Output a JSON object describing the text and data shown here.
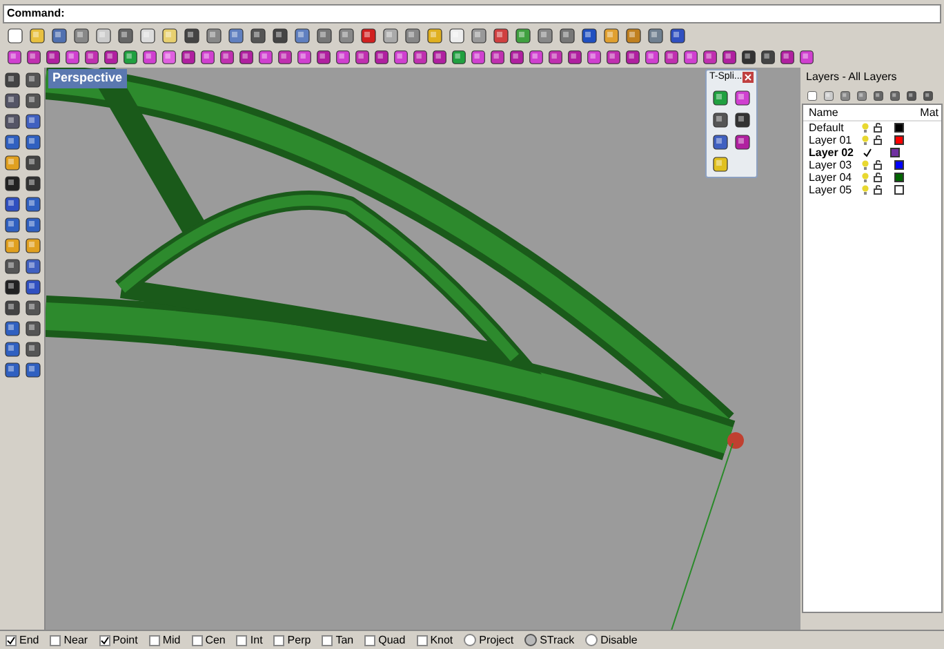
{
  "command_bar": {
    "label": "Command:"
  },
  "viewport": {
    "tab": "Perspective"
  },
  "tspline_panel": {
    "title": "T-Spli..."
  },
  "layers_panel": {
    "title": "Layers - All Layers",
    "columns": [
      "Name",
      "Mat"
    ],
    "layers": [
      {
        "name": "Default",
        "current": false,
        "color": "#000000"
      },
      {
        "name": "Layer 01",
        "current": false,
        "color": "#ff0000"
      },
      {
        "name": "Layer 02",
        "current": true,
        "color": "#7030a0"
      },
      {
        "name": "Layer 03",
        "current": false,
        "color": "#0000ff"
      },
      {
        "name": "Layer 04",
        "current": false,
        "color": "#006400"
      },
      {
        "name": "Layer 05",
        "current": false,
        "color": "#ffffff"
      }
    ]
  },
  "osnaps": [
    {
      "kind": "check",
      "label": "End",
      "checked": true
    },
    {
      "kind": "check",
      "label": "Near",
      "checked": false
    },
    {
      "kind": "check",
      "label": "Point",
      "checked": true
    },
    {
      "kind": "check",
      "label": "Mid",
      "checked": false
    },
    {
      "kind": "check",
      "label": "Cen",
      "checked": false
    },
    {
      "kind": "check",
      "label": "Int",
      "checked": false
    },
    {
      "kind": "check",
      "label": "Perp",
      "checked": false
    },
    {
      "kind": "check",
      "label": "Tan",
      "checked": false
    },
    {
      "kind": "check",
      "label": "Quad",
      "checked": false
    },
    {
      "kind": "check",
      "label": "Knot",
      "checked": false
    },
    {
      "kind": "toggle",
      "label": "Project",
      "checked": false
    },
    {
      "kind": "toggle",
      "label": "STrack",
      "checked": true
    },
    {
      "kind": "toggle",
      "label": "Disable",
      "checked": false
    }
  ]
}
